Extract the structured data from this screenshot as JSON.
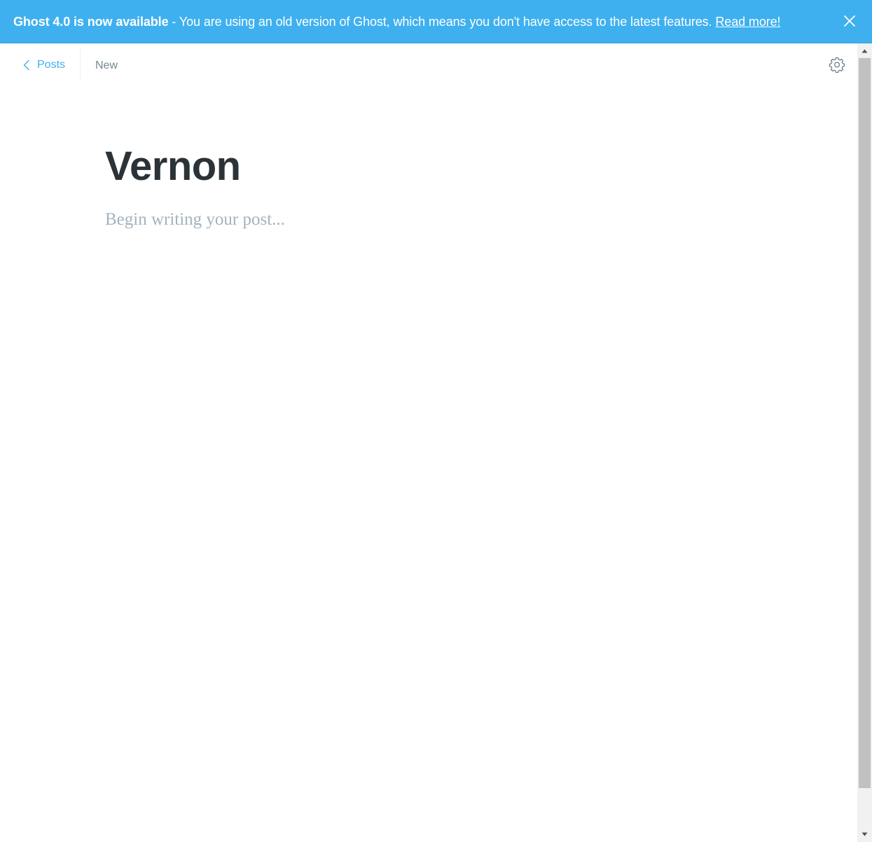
{
  "banner": {
    "title": "Ghost 4.0 is now available",
    "message": " - You are using an old version of Ghost, which means you don't have access to the latest features. ",
    "link_label": "Read more!",
    "close_icon": "close-icon"
  },
  "header": {
    "back_label": "Posts",
    "back_icon": "chevron-left-icon",
    "status": "New",
    "settings_icon": "gear-icon"
  },
  "editor": {
    "title": "Vernon",
    "body_placeholder": "Begin writing your post..."
  },
  "colors": {
    "accent": "#3eb0ef",
    "title": "#2b3338",
    "placeholder": "#a3b3be",
    "muted": "#738a94"
  }
}
